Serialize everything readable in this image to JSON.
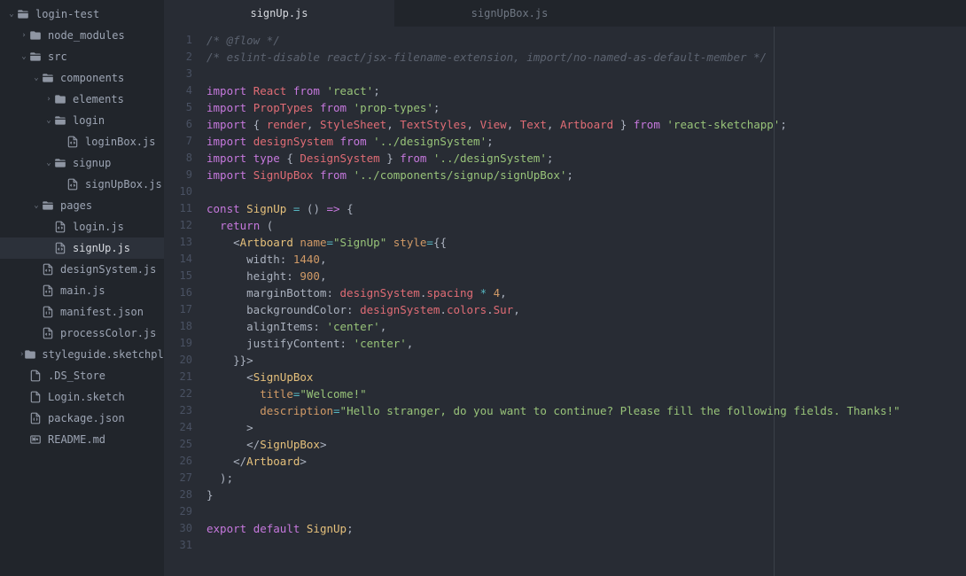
{
  "tabs": [
    {
      "label": "signUp.js",
      "active": true
    },
    {
      "label": "signUpBox.js",
      "active": false
    }
  ],
  "tree": [
    {
      "depth": 0,
      "arrow": "down",
      "icon": "folder-open",
      "label": "login-test",
      "selected": false
    },
    {
      "depth": 1,
      "arrow": "right",
      "icon": "folder",
      "label": "node_modules",
      "selected": false
    },
    {
      "depth": 1,
      "arrow": "down",
      "icon": "folder-open",
      "label": "src",
      "selected": false
    },
    {
      "depth": 2,
      "arrow": "down",
      "icon": "folder-open",
      "label": "components",
      "selected": false
    },
    {
      "depth": 3,
      "arrow": "right",
      "icon": "folder",
      "label": "elements",
      "selected": false
    },
    {
      "depth": 3,
      "arrow": "down",
      "icon": "folder-open",
      "label": "login",
      "selected": false
    },
    {
      "depth": 4,
      "arrow": "none",
      "icon": "file-code",
      "label": "loginBox.js",
      "selected": false
    },
    {
      "depth": 3,
      "arrow": "down",
      "icon": "folder-open",
      "label": "signup",
      "selected": false
    },
    {
      "depth": 4,
      "arrow": "none",
      "icon": "file-code",
      "label": "signUpBox.js",
      "selected": false
    },
    {
      "depth": 2,
      "arrow": "down",
      "icon": "folder-open",
      "label": "pages",
      "selected": false
    },
    {
      "depth": 3,
      "arrow": "none",
      "icon": "file-code",
      "label": "login.js",
      "selected": false
    },
    {
      "depth": 3,
      "arrow": "none",
      "icon": "file-code",
      "label": "signUp.js",
      "selected": true
    },
    {
      "depth": 2,
      "arrow": "none",
      "icon": "file-code",
      "label": "designSystem.js",
      "selected": false
    },
    {
      "depth": 2,
      "arrow": "none",
      "icon": "file-code",
      "label": "main.js",
      "selected": false
    },
    {
      "depth": 2,
      "arrow": "none",
      "icon": "file-json",
      "label": "manifest.json",
      "selected": false
    },
    {
      "depth": 2,
      "arrow": "none",
      "icon": "file-code",
      "label": "processColor.js",
      "selected": false
    },
    {
      "depth": 1,
      "arrow": "right",
      "icon": "folder",
      "label": "styleguide.sketchplugin",
      "selected": false
    },
    {
      "depth": 1,
      "arrow": "none",
      "icon": "file",
      "label": ".DS_Store",
      "selected": false
    },
    {
      "depth": 1,
      "arrow": "none",
      "icon": "file",
      "label": "Login.sketch",
      "selected": false
    },
    {
      "depth": 1,
      "arrow": "none",
      "icon": "file-json",
      "label": "package.json",
      "selected": false
    },
    {
      "depth": 1,
      "arrow": "none",
      "icon": "file-md",
      "label": "README.md",
      "selected": false
    }
  ],
  "code": [
    [
      {
        "c": "c-comment",
        "t": "/* @flow */"
      }
    ],
    [
      {
        "c": "c-comment",
        "t": "/* eslint-disable react/jsx-filename-extension, import/no-named-as-default-member */"
      }
    ],
    [],
    [
      {
        "c": "c-keyword",
        "t": "import"
      },
      {
        "c": "c-punct",
        "t": " "
      },
      {
        "c": "c-var",
        "t": "React"
      },
      {
        "c": "c-punct",
        "t": " "
      },
      {
        "c": "c-keyword",
        "t": "from"
      },
      {
        "c": "c-punct",
        "t": " "
      },
      {
        "c": "c-string",
        "t": "'react'"
      },
      {
        "c": "c-punct",
        "t": ";"
      }
    ],
    [
      {
        "c": "c-keyword",
        "t": "import"
      },
      {
        "c": "c-punct",
        "t": " "
      },
      {
        "c": "c-var",
        "t": "PropTypes"
      },
      {
        "c": "c-punct",
        "t": " "
      },
      {
        "c": "c-keyword",
        "t": "from"
      },
      {
        "c": "c-punct",
        "t": " "
      },
      {
        "c": "c-string",
        "t": "'prop-types'"
      },
      {
        "c": "c-punct",
        "t": ";"
      }
    ],
    [
      {
        "c": "c-keyword",
        "t": "import"
      },
      {
        "c": "c-punct",
        "t": " { "
      },
      {
        "c": "c-var",
        "t": "render"
      },
      {
        "c": "c-punct",
        "t": ", "
      },
      {
        "c": "c-var",
        "t": "StyleSheet"
      },
      {
        "c": "c-punct",
        "t": ", "
      },
      {
        "c": "c-var",
        "t": "TextStyles"
      },
      {
        "c": "c-punct",
        "t": ", "
      },
      {
        "c": "c-var",
        "t": "View"
      },
      {
        "c": "c-punct",
        "t": ", "
      },
      {
        "c": "c-var",
        "t": "Text"
      },
      {
        "c": "c-punct",
        "t": ", "
      },
      {
        "c": "c-var",
        "t": "Artboard"
      },
      {
        "c": "c-punct",
        "t": " } "
      },
      {
        "c": "c-keyword",
        "t": "from"
      },
      {
        "c": "c-punct",
        "t": " "
      },
      {
        "c": "c-string",
        "t": "'react-sketchapp'"
      },
      {
        "c": "c-punct",
        "t": ";"
      }
    ],
    [
      {
        "c": "c-keyword",
        "t": "import"
      },
      {
        "c": "c-punct",
        "t": " "
      },
      {
        "c": "c-var",
        "t": "designSystem"
      },
      {
        "c": "c-punct",
        "t": " "
      },
      {
        "c": "c-keyword",
        "t": "from"
      },
      {
        "c": "c-punct",
        "t": " "
      },
      {
        "c": "c-string",
        "t": "'../designSystem'"
      },
      {
        "c": "c-punct",
        "t": ";"
      }
    ],
    [
      {
        "c": "c-keyword",
        "t": "import"
      },
      {
        "c": "c-punct",
        "t": " "
      },
      {
        "c": "c-keyword",
        "t": "type"
      },
      {
        "c": "c-punct",
        "t": " { "
      },
      {
        "c": "c-var",
        "t": "DesignSystem"
      },
      {
        "c": "c-punct",
        "t": " } "
      },
      {
        "c": "c-keyword",
        "t": "from"
      },
      {
        "c": "c-punct",
        "t": " "
      },
      {
        "c": "c-string",
        "t": "'../designSystem'"
      },
      {
        "c": "c-punct",
        "t": ";"
      }
    ],
    [
      {
        "c": "c-keyword",
        "t": "import"
      },
      {
        "c": "c-punct",
        "t": " "
      },
      {
        "c": "c-var",
        "t": "SignUpBox"
      },
      {
        "c": "c-punct",
        "t": " "
      },
      {
        "c": "c-keyword",
        "t": "from"
      },
      {
        "c": "c-punct",
        "t": " "
      },
      {
        "c": "c-string",
        "t": "'../components/signup/signUpBox'"
      },
      {
        "c": "c-punct",
        "t": ";"
      }
    ],
    [],
    [
      {
        "c": "c-keyword",
        "t": "const"
      },
      {
        "c": "c-punct",
        "t": " "
      },
      {
        "c": "c-class",
        "t": "SignUp"
      },
      {
        "c": "c-punct",
        "t": " "
      },
      {
        "c": "c-op",
        "t": "="
      },
      {
        "c": "c-punct",
        "t": " () "
      },
      {
        "c": "c-keyword",
        "t": "=>"
      },
      {
        "c": "c-punct",
        "t": " {"
      }
    ],
    [
      {
        "c": "c-punct",
        "t": "  "
      },
      {
        "c": "c-keyword",
        "t": "return"
      },
      {
        "c": "c-punct",
        "t": " ("
      }
    ],
    [
      {
        "c": "c-punct",
        "t": "    <"
      },
      {
        "c": "c-class",
        "t": "Artboard"
      },
      {
        "c": "c-punct",
        "t": " "
      },
      {
        "c": "c-attr",
        "t": "name"
      },
      {
        "c": "c-op",
        "t": "="
      },
      {
        "c": "c-string",
        "t": "\"SignUp\""
      },
      {
        "c": "c-punct",
        "t": " "
      },
      {
        "c": "c-attr",
        "t": "style"
      },
      {
        "c": "c-op",
        "t": "="
      },
      {
        "c": "c-punct",
        "t": "{{"
      }
    ],
    [
      {
        "c": "c-punct",
        "t": "      width: "
      },
      {
        "c": "c-const",
        "t": "1440"
      },
      {
        "c": "c-punct",
        "t": ","
      }
    ],
    [
      {
        "c": "c-punct",
        "t": "      height: "
      },
      {
        "c": "c-const",
        "t": "900"
      },
      {
        "c": "c-punct",
        "t": ","
      }
    ],
    [
      {
        "c": "c-punct",
        "t": "      marginBottom: "
      },
      {
        "c": "c-var",
        "t": "designSystem"
      },
      {
        "c": "c-punct",
        "t": "."
      },
      {
        "c": "c-var",
        "t": "spacing"
      },
      {
        "c": "c-punct",
        "t": " "
      },
      {
        "c": "c-op",
        "t": "*"
      },
      {
        "c": "c-punct",
        "t": " "
      },
      {
        "c": "c-const",
        "t": "4"
      },
      {
        "c": "c-punct",
        "t": ","
      }
    ],
    [
      {
        "c": "c-punct",
        "t": "      backgroundColor: "
      },
      {
        "c": "c-var",
        "t": "designSystem"
      },
      {
        "c": "c-punct",
        "t": "."
      },
      {
        "c": "c-var",
        "t": "colors"
      },
      {
        "c": "c-punct",
        "t": "."
      },
      {
        "c": "c-var",
        "t": "Sur"
      },
      {
        "c": "c-punct",
        "t": ","
      }
    ],
    [
      {
        "c": "c-punct",
        "t": "      alignItems: "
      },
      {
        "c": "c-string",
        "t": "'center'"
      },
      {
        "c": "c-punct",
        "t": ","
      }
    ],
    [
      {
        "c": "c-punct",
        "t": "      justifyContent: "
      },
      {
        "c": "c-string",
        "t": "'center'"
      },
      {
        "c": "c-punct",
        "t": ","
      }
    ],
    [
      {
        "c": "c-punct",
        "t": "    }}>"
      }
    ],
    [
      {
        "c": "c-punct",
        "t": "      <"
      },
      {
        "c": "c-class",
        "t": "SignUpBox"
      }
    ],
    [
      {
        "c": "c-punct",
        "t": "        "
      },
      {
        "c": "c-attr",
        "t": "title"
      },
      {
        "c": "c-op",
        "t": "="
      },
      {
        "c": "c-string",
        "t": "\"Welcome!\""
      }
    ],
    [
      {
        "c": "c-punct",
        "t": "        "
      },
      {
        "c": "c-attr",
        "t": "description"
      },
      {
        "c": "c-op",
        "t": "="
      },
      {
        "c": "c-string",
        "t": "\"Hello stranger, do you want to continue? Please fill the following fields. Thanks!\""
      }
    ],
    [
      {
        "c": "c-punct",
        "t": "      >"
      }
    ],
    [
      {
        "c": "c-punct",
        "t": "      </"
      },
      {
        "c": "c-class",
        "t": "SignUpBox"
      },
      {
        "c": "c-punct",
        "t": ">"
      }
    ],
    [
      {
        "c": "c-punct",
        "t": "    </"
      },
      {
        "c": "c-class",
        "t": "Artboard"
      },
      {
        "c": "c-punct",
        "t": ">"
      }
    ],
    [
      {
        "c": "c-punct",
        "t": "  );"
      }
    ],
    [
      {
        "c": "c-punct",
        "t": "}"
      }
    ],
    [],
    [
      {
        "c": "c-keyword",
        "t": "export"
      },
      {
        "c": "c-punct",
        "t": " "
      },
      {
        "c": "c-keyword",
        "t": "default"
      },
      {
        "c": "c-punct",
        "t": " "
      },
      {
        "c": "c-class",
        "t": "SignUp"
      },
      {
        "c": "c-punct",
        "t": ";"
      }
    ],
    []
  ],
  "icons": {
    "folder-open": "<svg width='14' height='14' viewBox='0 0 24 24' fill='#8f96a3'><path d='M20 6h-8l-2-2H4a2 2 0 0 0-2 2v2h20V8a2 2 0 0 0-2-2zM2 10v8a2 2 0 0 0 2 2h16a2 2 0 0 0 2-2v-8H2z'/></svg>",
    "folder": "<svg width='14' height='14' viewBox='0 0 24 24' fill='#8f96a3'><path d='M10 4H4a2 2 0 0 0-2 2v12a2 2 0 0 0 2 2h16a2 2 0 0 0 2-2V8a2 2 0 0 0-2-2h-8l-2-2z'/></svg>",
    "file-code": "<svg width='14' height='14' viewBox='0 0 24 24' fill='none' stroke='#8f96a3' stroke-width='2'><path d='M14 2H6a2 2 0 0 0-2 2v16a2 2 0 0 0 2 2h12a2 2 0 0 0 2-2V8z'/><polyline points='14 2 14 8 20 8'/><polyline points='10 12 8 14 10 16'/><polyline points='14 12 16 14 14 16'/></svg>",
    "file-json": "<svg width='14' height='14' viewBox='0 0 24 24' fill='none' stroke='#8f96a3' stroke-width='2'><path d='M14 2H6a2 2 0 0 0-2 2v16a2 2 0 0 0 2 2h12a2 2 0 0 0 2-2V8z'/><polyline points='14 2 14 8 20 8'/><path d='M10 12c-1 0-1 1-1 2s0 2 1 2M14 12c1 0 1 1 1 2s0 2-1 2'/></svg>",
    "file-md": "<svg width='14' height='14' viewBox='0 0 24 24' fill='none' stroke='#8f96a3' stroke-width='2'><rect x='3' y='5' width='18' height='14' rx='2'/><path d='M7 15V9l2 3 2-3v6M15 9v4m0 0l-2-2m2 2l2-2'/></svg>",
    "file": "<svg width='14' height='14' viewBox='0 0 24 24' fill='none' stroke='#8f96a3' stroke-width='2'><path d='M14 2H6a2 2 0 0 0-2 2v16a2 2 0 0 0 2 2h12a2 2 0 0 0 2-2V8z'/><polyline points='14 2 14 8 20 8'/></svg>"
  }
}
